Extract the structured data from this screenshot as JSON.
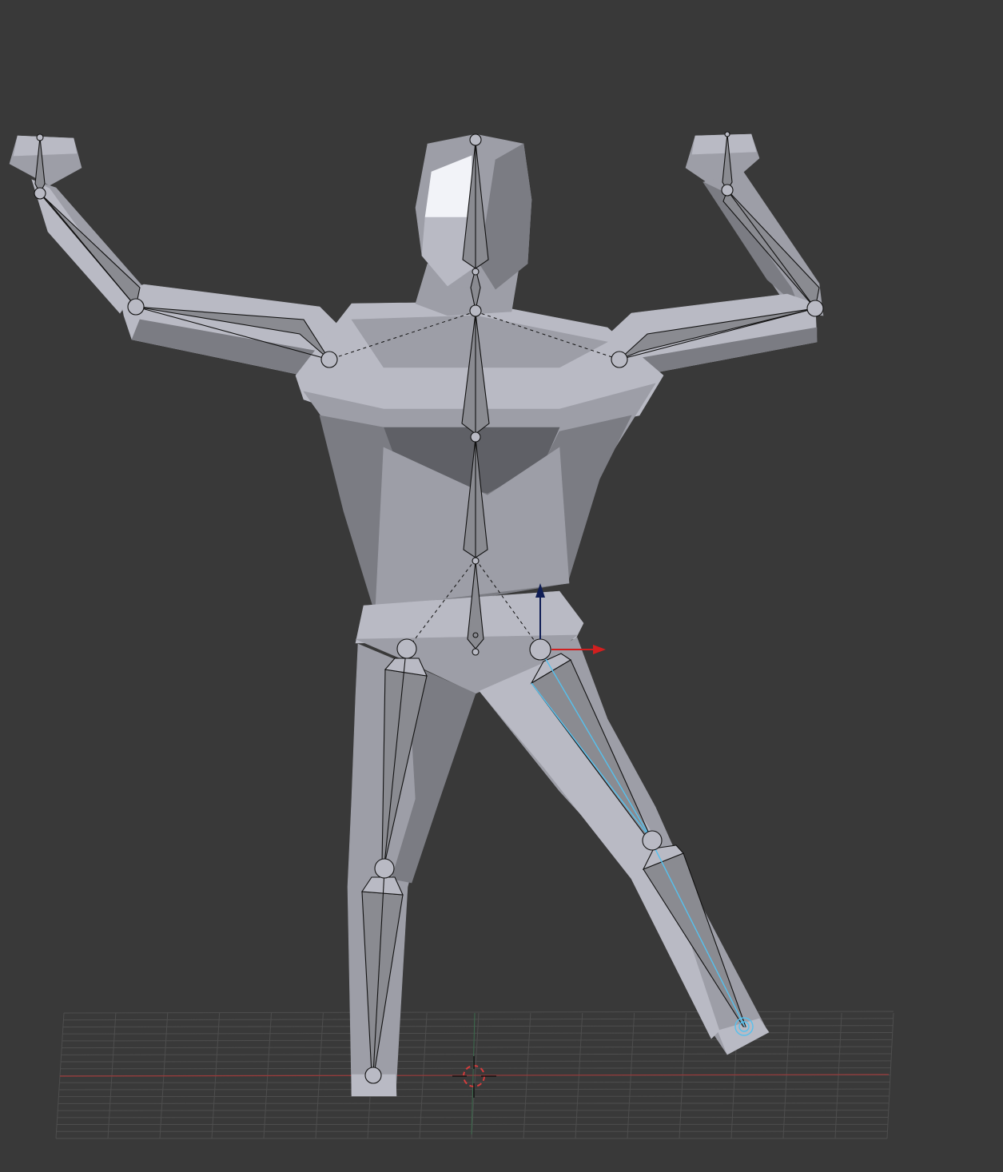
{
  "viewport": {
    "background": "#393939",
    "mesh_light": "#b9bac4",
    "mesh_mid": "#9d9ea7",
    "mesh_dark": "#7b7c83",
    "mesh_shadow": "#5f6066",
    "mesh_highlight": "#f2f3f8",
    "bone_color": "#8a8b91",
    "selection_color": "#56c1ee",
    "grid_color": "#4e4e4e",
    "x_axis_color": "#9c3a3a",
    "y_axis_color": "#3c6b4d"
  },
  "gizmo": {
    "x_axis_color": "#d11f1f",
    "z_axis_color": "#101e55"
  },
  "cursor": {
    "ring_color": "#d43c3c",
    "cross_color": "#111111"
  },
  "armature": {
    "bones": [
      "head",
      "neck",
      "chest",
      "spine",
      "spine-lower",
      "hips",
      "shoulder-left",
      "upper-arm-left",
      "forearm-left",
      "hand-left",
      "shoulder-right",
      "upper-arm-right",
      "forearm-right",
      "hand-right",
      "thigh-left",
      "shin-left",
      "thigh-right",
      "shin-right"
    ],
    "selected": [
      "thigh-right",
      "shin-right"
    ]
  }
}
